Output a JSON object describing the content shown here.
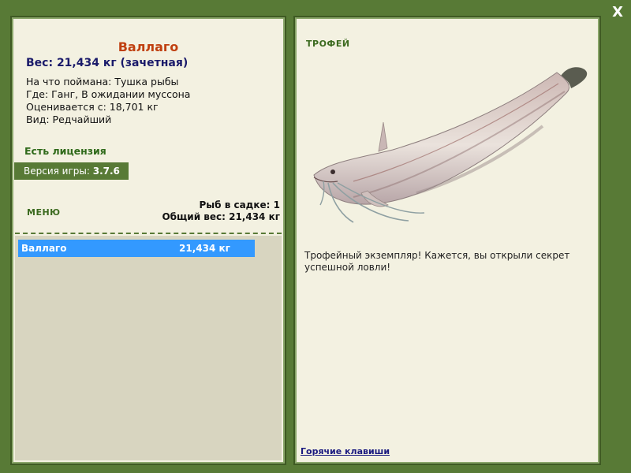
{
  "close_label": "X",
  "left": {
    "fish_name": "Валлаго",
    "weight_line": "Вес: 21,434 кг (зачетная)",
    "info": [
      "На что поймана: Тушка рыбы",
      "Где: Ганг, В ожидании муссона",
      "Оценивается с: 18,701 кг",
      "Вид: Редчайший"
    ],
    "license": "Есть лицензия",
    "version_label": "Версия игры:",
    "version_value": "3.7.6",
    "menu_label": "МЕНЮ",
    "cage_count": "Рыб в садке: 1",
    "cage_total": "Общий вес: 21,434 кг",
    "catch_list": [
      {
        "name": "Валлаго",
        "weight": "21,434 кг"
      }
    ]
  },
  "right": {
    "trophy_label": "ТРОФЕЙ",
    "trophy_text": "Трофейный экземпляр! Кажется, вы открыли секрет успешной ловли!",
    "hotkeys": "Горячие клавиши"
  },
  "colors": {
    "background": "#587a36",
    "panel": "#f3f1e1",
    "title": "#c04010",
    "weight": "#1a1a6a",
    "selection": "#3399ff"
  }
}
